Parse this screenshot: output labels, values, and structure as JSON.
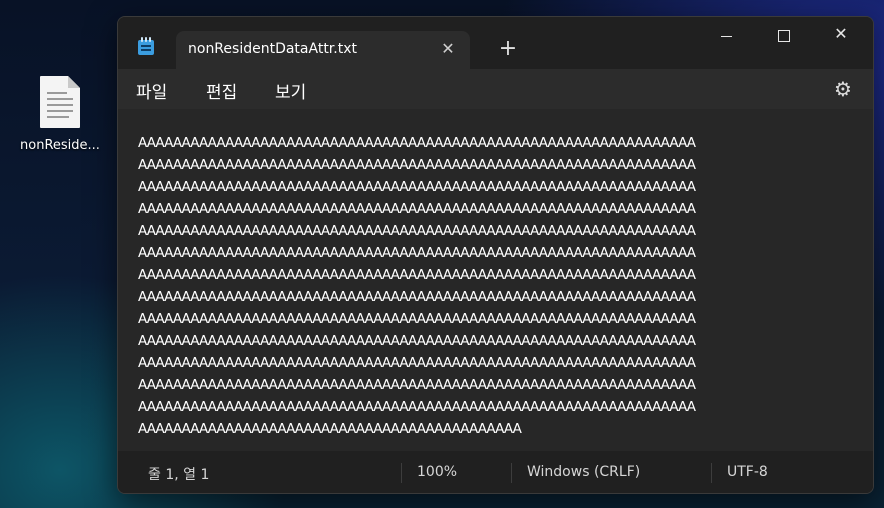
{
  "desktop": {
    "icon_label": "nonReside...",
    "icon_name": "text-file-icon"
  },
  "window": {
    "tab_title": "nonResidentDataAttr.txt",
    "menu": [
      "파일",
      "편집",
      "보기"
    ],
    "lines": [
      "AAAAAAAAAAAAAAAAAAAAAAAAAAAAAAAAAAAAAAAAAAAAAAAAAAAAAAAAAAAAAAAA",
      "AAAAAAAAAAAAAAAAAAAAAAAAAAAAAAAAAAAAAAAAAAAAAAAAAAAAAAAAAAAAAAAA",
      "AAAAAAAAAAAAAAAAAAAAAAAAAAAAAAAAAAAAAAAAAAAAAAAAAAAAAAAAAAAAAAAA",
      "AAAAAAAAAAAAAAAAAAAAAAAAAAAAAAAAAAAAAAAAAAAAAAAAAAAAAAAAAAAAAAAA",
      "AAAAAAAAAAAAAAAAAAAAAAAAAAAAAAAAAAAAAAAAAAAAAAAAAAAAAAAAAAAAAAAA",
      "AAAAAAAAAAAAAAAAAAAAAAAAAAAAAAAAAAAAAAAAAAAAAAAAAAAAAAAAAAAAAAAA",
      "AAAAAAAAAAAAAAAAAAAAAAAAAAAAAAAAAAAAAAAAAAAAAAAAAAAAAAAAAAAAAAAA",
      "AAAAAAAAAAAAAAAAAAAAAAAAAAAAAAAAAAAAAAAAAAAAAAAAAAAAAAAAAAAAAAAA",
      "AAAAAAAAAAAAAAAAAAAAAAAAAAAAAAAAAAAAAAAAAAAAAAAAAAAAAAAAAAAAAAAA",
      "AAAAAAAAAAAAAAAAAAAAAAAAAAAAAAAAAAAAAAAAAAAAAAAAAAAAAAAAAAAAAAAA",
      "AAAAAAAAAAAAAAAAAAAAAAAAAAAAAAAAAAAAAAAAAAAAAAAAAAAAAAAAAAAAAAAA",
      "AAAAAAAAAAAAAAAAAAAAAAAAAAAAAAAAAAAAAAAAAAAAAAAAAAAAAAAAAAAAAAAA",
      "AAAAAAAAAAAAAAAAAAAAAAAAAAAAAAAAAAAAAAAAAAAAAAAAAAAAAAAAAAAAAAAA",
      "AAAAAAAAAAAAAAAAAAAAAAAAAAAAAAAAAAAAAAAAAAAA"
    ],
    "status": {
      "position": "줄 1, 열 1",
      "zoom": "100%",
      "line_ending": "Windows (CRLF)",
      "encoding": "UTF-8"
    },
    "icons": {
      "app": "notepad-icon",
      "close_tab": "close-icon",
      "new_tab": "plus-icon",
      "minimize": "minimize-icon",
      "maximize": "maximize-icon",
      "close_window": "close-icon",
      "settings": "gear-icon"
    },
    "colors": {
      "titlebar": "#202020",
      "menubar": "#2c2c2c",
      "editor_bg": "#272727",
      "text": "#ffffff",
      "app_icon": "#3b9de0"
    }
  }
}
